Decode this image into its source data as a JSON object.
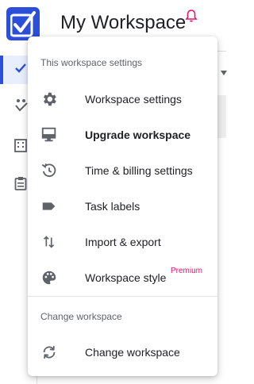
{
  "app": {
    "title": "My Workspace"
  },
  "menu": {
    "section1_header": "This workspace settings",
    "items": [
      {
        "label": "Workspace settings",
        "icon": "gear-icon"
      },
      {
        "label": "Upgrade workspace",
        "icon": "monitor-icon"
      },
      {
        "label": "Time & billing settings",
        "icon": "clock-refresh-icon"
      },
      {
        "label": "Task labels",
        "icon": "label-icon"
      },
      {
        "label": "Import & export",
        "icon": "swap-vertical-icon"
      },
      {
        "label": "Workspace style",
        "icon": "palette-icon",
        "badge": "Premium"
      }
    ],
    "section2_header": "Change workspace",
    "change_item": {
      "label": "Change workspace",
      "icon": "sync-icon"
    }
  },
  "colors": {
    "brand": "#2b4fd8",
    "badge": "#e3166d",
    "bell": "#e3166d"
  }
}
